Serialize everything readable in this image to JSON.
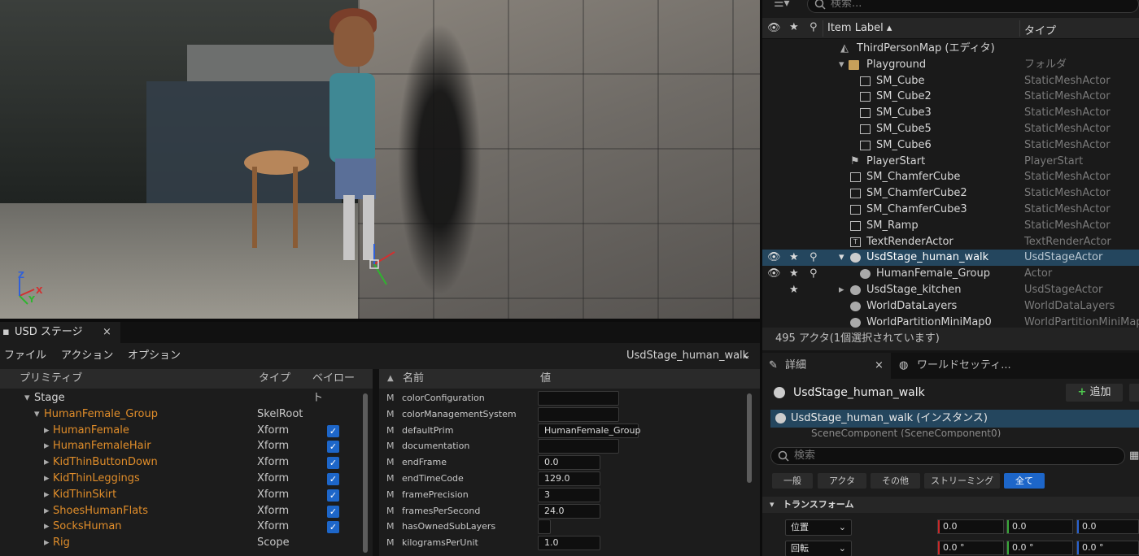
{
  "outliner": {
    "search_placeholder": "検索...",
    "col_label": "Item Label ▴",
    "col_type": "タイプ",
    "rows": [
      {
        "label": "ThirdPersonMap (エディタ)",
        "type": ""
      },
      {
        "label": "Playground",
        "type": "フォルダ"
      },
      {
        "label": "SM_Cube",
        "type": "StaticMeshActor"
      },
      {
        "label": "SM_Cube2",
        "type": "StaticMeshActor"
      },
      {
        "label": "SM_Cube3",
        "type": "StaticMeshActor"
      },
      {
        "label": "SM_Cube5",
        "type": "StaticMeshActor"
      },
      {
        "label": "SM_Cube6",
        "type": "StaticMeshActor"
      },
      {
        "label": "PlayerStart",
        "type": "PlayerStart"
      },
      {
        "label": "SM_ChamferCube",
        "type": "StaticMeshActor"
      },
      {
        "label": "SM_ChamferCube2",
        "type": "StaticMeshActor"
      },
      {
        "label": "SM_ChamferCube3",
        "type": "StaticMeshActor"
      },
      {
        "label": "SM_Ramp",
        "type": "StaticMeshActor"
      },
      {
        "label": "TextRenderActor",
        "type": "TextRenderActor"
      },
      {
        "label": "UsdStage_human_walk",
        "type": "UsdStageActor"
      },
      {
        "label": "HumanFemale_Group",
        "type": "Actor"
      },
      {
        "label": "UsdStage_kitchen",
        "type": "UsdStageActor"
      },
      {
        "label": "WorldDataLayers",
        "type": "WorldDataLayers"
      },
      {
        "label": "WorldPartitionMiniMap0",
        "type": "WorldPartitionMiniMap"
      }
    ],
    "status": "495 アクタ(1個選択されています)"
  },
  "usd": {
    "tab_title": "USD ステージ",
    "tab_close": "×",
    "menu": {
      "file": "ファイル",
      "action": "アクション",
      "options": "オプション"
    },
    "stage_selector": "UsdStage_human_walk",
    "prim_headers": {
      "primitive": "プリミティブ",
      "type": "タイプ",
      "bake": "ベイロート"
    },
    "prims": [
      {
        "name": "Stage",
        "type": "",
        "checked": false
      },
      {
        "name": "HumanFemale_Group",
        "type": "SkelRoot",
        "checked": false
      },
      {
        "name": "HumanFemale",
        "type": "Xform",
        "checked": true
      },
      {
        "name": "HumanFemaleHair",
        "type": "Xform",
        "checked": true
      },
      {
        "name": "KidThinButtonDown",
        "type": "Xform",
        "checked": true
      },
      {
        "name": "KidThinLeggings",
        "type": "Xform",
        "checked": true
      },
      {
        "name": "KidThinSkirt",
        "type": "Xform",
        "checked": true
      },
      {
        "name": "ShoesHumanFlats",
        "type": "Xform",
        "checked": true
      },
      {
        "name": "SocksHuman",
        "type": "Xform",
        "checked": true
      },
      {
        "name": "Rig",
        "type": "Scope",
        "checked": false
      }
    ],
    "prop_headers": {
      "name": "名前",
      "value": "値"
    },
    "properties": [
      {
        "m": "M",
        "key": "colorConfiguration",
        "value": ""
      },
      {
        "m": "M",
        "key": "colorManagementSystem",
        "value": ""
      },
      {
        "m": "M",
        "key": "defaultPrim",
        "value": "HumanFemale_Group"
      },
      {
        "m": "M",
        "key": "documentation",
        "value": ""
      },
      {
        "m": "M",
        "key": "endFrame",
        "value": "0.0"
      },
      {
        "m": "M",
        "key": "endTimeCode",
        "value": "129.0"
      },
      {
        "m": "M",
        "key": "framePrecision",
        "value": "3"
      },
      {
        "m": "M",
        "key": "framesPerSecond",
        "value": "24.0"
      },
      {
        "m": "M",
        "key": "hasOwnedSubLayers",
        "value": ""
      },
      {
        "m": "M",
        "key": "kilogramsPerUnit",
        "value": "1.0"
      }
    ]
  },
  "details": {
    "tab_details": "詳細",
    "tab_close": "×",
    "tab_world": "ワールドセッティ...",
    "actor_name": "UsdStage_human_walk",
    "add_button": "追加",
    "component_selected": "UsdStage_human_walk (インスタンス)",
    "component_sub": "SceneComponent (SceneComponent0)",
    "search_placeholder": "検索",
    "filters": [
      "一般",
      "アクタ",
      "その他",
      "ストリーミング",
      "全て"
    ],
    "section_title": "トランスフォーム",
    "transform": [
      {
        "label": "位置",
        "x": "0.0",
        "y": "0.0",
        "z": "0.0"
      },
      {
        "label": "回転",
        "x": "0.0 °",
        "y": "0.0 °",
        "z": "0.0 °"
      }
    ]
  },
  "viewport": {
    "axis_x": "X",
    "axis_y": "Y",
    "axis_z": "Z"
  },
  "colors": {
    "accent": "#1d66c9",
    "selection": "#24465e",
    "prim_name": "#e08d2a"
  }
}
